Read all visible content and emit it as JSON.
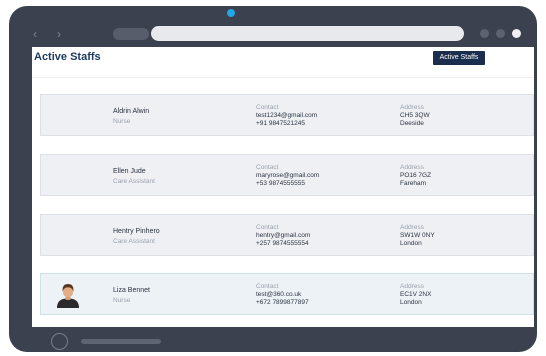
{
  "browser": {
    "back_glyph": "‹",
    "forward_glyph": "›"
  },
  "page": {
    "title": "Active Staffs",
    "active_staffs_button": "Active Staffs"
  },
  "columns": {
    "contact_label": "Contact",
    "address_label": "Address"
  },
  "staff": [
    {
      "name": "Aldrin Alwin",
      "role": "Nurse",
      "email": "test1234@gmail.com",
      "phone": "+91 9847521245",
      "postcode": "CH5 3QW",
      "city": "Deeside",
      "has_avatar": false
    },
    {
      "name": "Ellen Jude",
      "role": "Care Assistant",
      "email": "maryrose@gmail.com",
      "phone": "+53 9874555555",
      "postcode": "PO16 7GZ",
      "city": "Fareham",
      "has_avatar": false
    },
    {
      "name": "Hentry Pinhero",
      "role": "Care Assistant",
      "email": "hentry@gmail.com",
      "phone": "+257 9874555554",
      "postcode": "SW1W 0NY",
      "city": "London",
      "has_avatar": false
    },
    {
      "name": "Liza Bennet",
      "role": "Nurse",
      "email": "test@360.co.uk",
      "phone": "+672 7899877897",
      "postcode": "EC1V 2NX",
      "city": "London",
      "has_avatar": true,
      "selected": true
    }
  ],
  "icons": {
    "avatar": "person-avatar-icon",
    "camera": "camera-icon",
    "home": "home-button-icon"
  },
  "colors": {
    "brand_dark": "#1b2e4e",
    "title": "#1e3c63",
    "device_frame": "#3c4150",
    "camera": "#23a5e6"
  }
}
